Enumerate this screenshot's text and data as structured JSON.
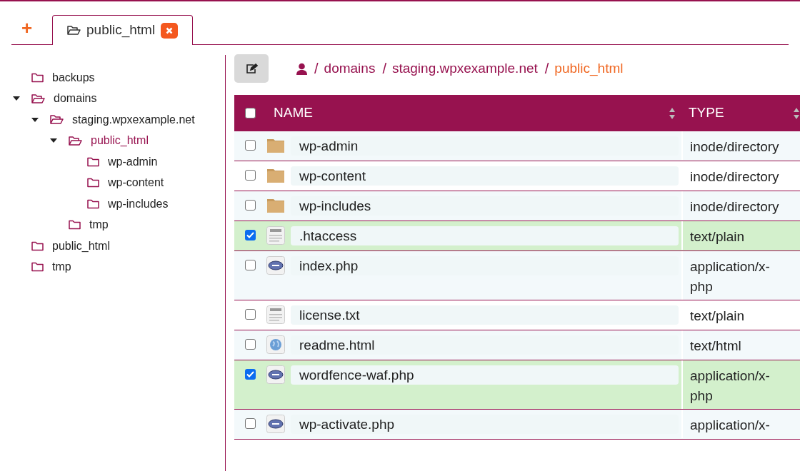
{
  "tabs": [
    {
      "kind": "add",
      "label": "+",
      "selected": false
    },
    {
      "kind": "folder",
      "label": "public_html",
      "selected": true
    }
  ],
  "tree": [
    {
      "label": "backups",
      "expanded": false,
      "selected": false
    },
    {
      "label": "domains",
      "expanded": true,
      "selected": false,
      "children": [
        {
          "label": "staging.wpxexample.net",
          "expanded": true,
          "selected": false,
          "children": [
            {
              "label": "public_html",
              "expanded": true,
              "selected": true,
              "children": [
                {
                  "label": "wp-admin",
                  "expanded": false,
                  "selected": false
                },
                {
                  "label": "wp-content",
                  "expanded": false,
                  "selected": false
                },
                {
                  "label": "wp-includes",
                  "expanded": false,
                  "selected": false
                }
              ]
            },
            {
              "label": "tmp",
              "expanded": false,
              "selected": false
            }
          ]
        }
      ]
    },
    {
      "label": "public_html",
      "expanded": false,
      "selected": false
    },
    {
      "label": "tmp",
      "expanded": false,
      "selected": false
    }
  ],
  "breadcrumb": [
    {
      "separator": "/",
      "label": "domains",
      "selected": false
    },
    {
      "separator": "/",
      "label": "staging.wpxexample.net",
      "selected": false
    },
    {
      "separator": "/",
      "label": "public_html",
      "selected": true
    }
  ],
  "table": {
    "select_all_checked": false,
    "columns": [
      "NAME",
      "TYPE"
    ],
    "rows": [
      {
        "kind": "folder",
        "name": "wp-admin",
        "type": "inode/directory",
        "checked": false
      },
      {
        "kind": "folder",
        "name": "wp-content",
        "type": "inode/directory",
        "checked": false
      },
      {
        "kind": "folder",
        "name": "wp-includes",
        "type": "inode/directory",
        "checked": false
      },
      {
        "kind": "text",
        "name": ".htaccess",
        "type": "text/plain",
        "checked": true
      },
      {
        "kind": "php",
        "name": "index.php",
        "type": "application/x-php",
        "checked": false
      },
      {
        "kind": "text",
        "name": "license.txt",
        "type": "text/plain",
        "checked": false
      },
      {
        "kind": "html",
        "name": "readme.html",
        "type": "text/html",
        "checked": false
      },
      {
        "kind": "php",
        "name": "wordfence-waf.php",
        "type": "application/x-php",
        "checked": true
      },
      {
        "kind": "php",
        "name": "wp-activate.php",
        "type": "application/x-",
        "checked": false
      }
    ]
  }
}
